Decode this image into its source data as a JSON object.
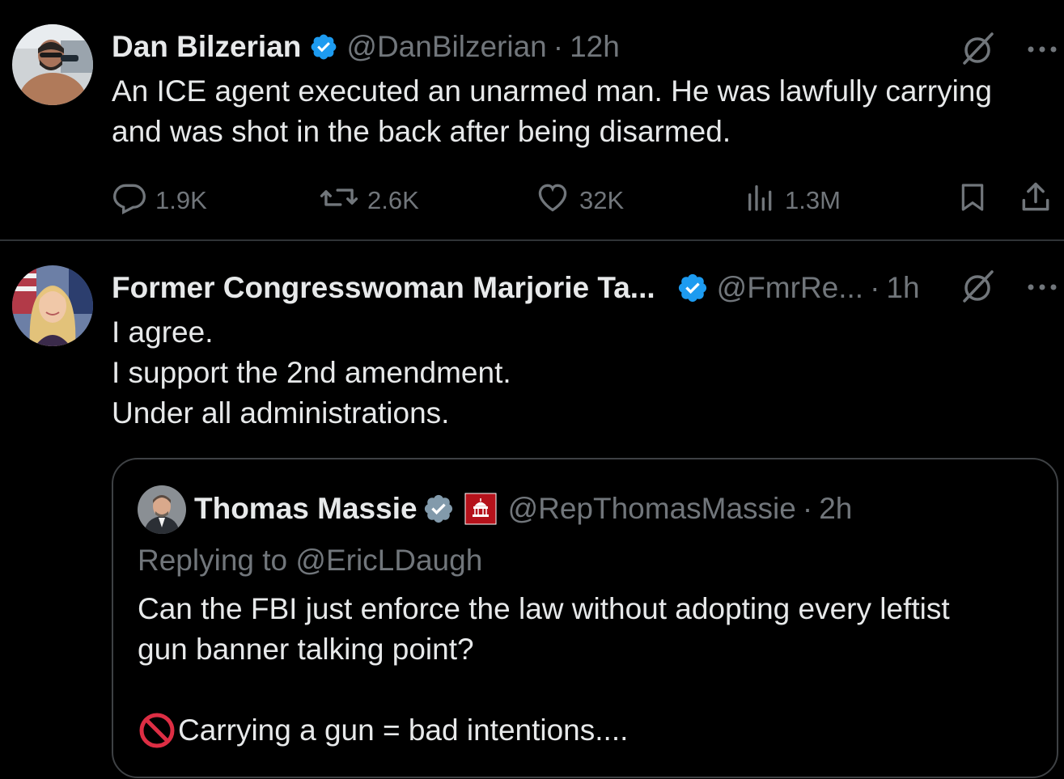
{
  "colors": {
    "background": "#000000",
    "text_primary": "#e7e9ea",
    "text_secondary": "#71767b",
    "verified_blue": "#1d9bf0",
    "verified_gray": "#829aab",
    "divider": "#2f3336",
    "quote_border": "#3e4144",
    "prohibited_red": "#dd2e44"
  },
  "tweets": [
    {
      "author_name": "Dan Bilzerian",
      "verified": "blue",
      "handle": "@DanBilzerian",
      "separator": "·",
      "time": "12h",
      "text_lines": [
        "An ICE agent executed an unarmed man. He was lawfully carrying",
        "and was shot in the back after being disarmed."
      ],
      "actions": {
        "replies": "1.9K",
        "reposts": "2.6K",
        "likes": "32K",
        "views": "1.3M"
      },
      "icons": [
        "grok-icon",
        "more-icon",
        "reply-icon",
        "repost-icon",
        "like-icon",
        "views-icon",
        "bookmark-icon",
        "share-icon"
      ]
    },
    {
      "author_name": "Former Congresswoman Marjorie Ta...",
      "verified": "blue",
      "handle": "@FmrRe...",
      "separator": "·",
      "time": "1h",
      "text_lines": [
        "I agree.",
        "I support the 2nd amendment.",
        "Under all administrations."
      ],
      "quote": {
        "author_name": "Thomas Massie",
        "verified": "gray",
        "affiliate_badge": "gop-capitol-icon",
        "handle": "@RepThomasMassie",
        "separator": "·",
        "time": "2h",
        "replying_to": "Replying to @EricLDaugh",
        "text_lines": [
          "Can the FBI just enforce the law without adopting every leftist",
          "gun banner talking point?"
        ],
        "last_line": "Carrying a gun = bad intentions....",
        "last_line_icon": "prohibited-icon"
      }
    }
  ]
}
